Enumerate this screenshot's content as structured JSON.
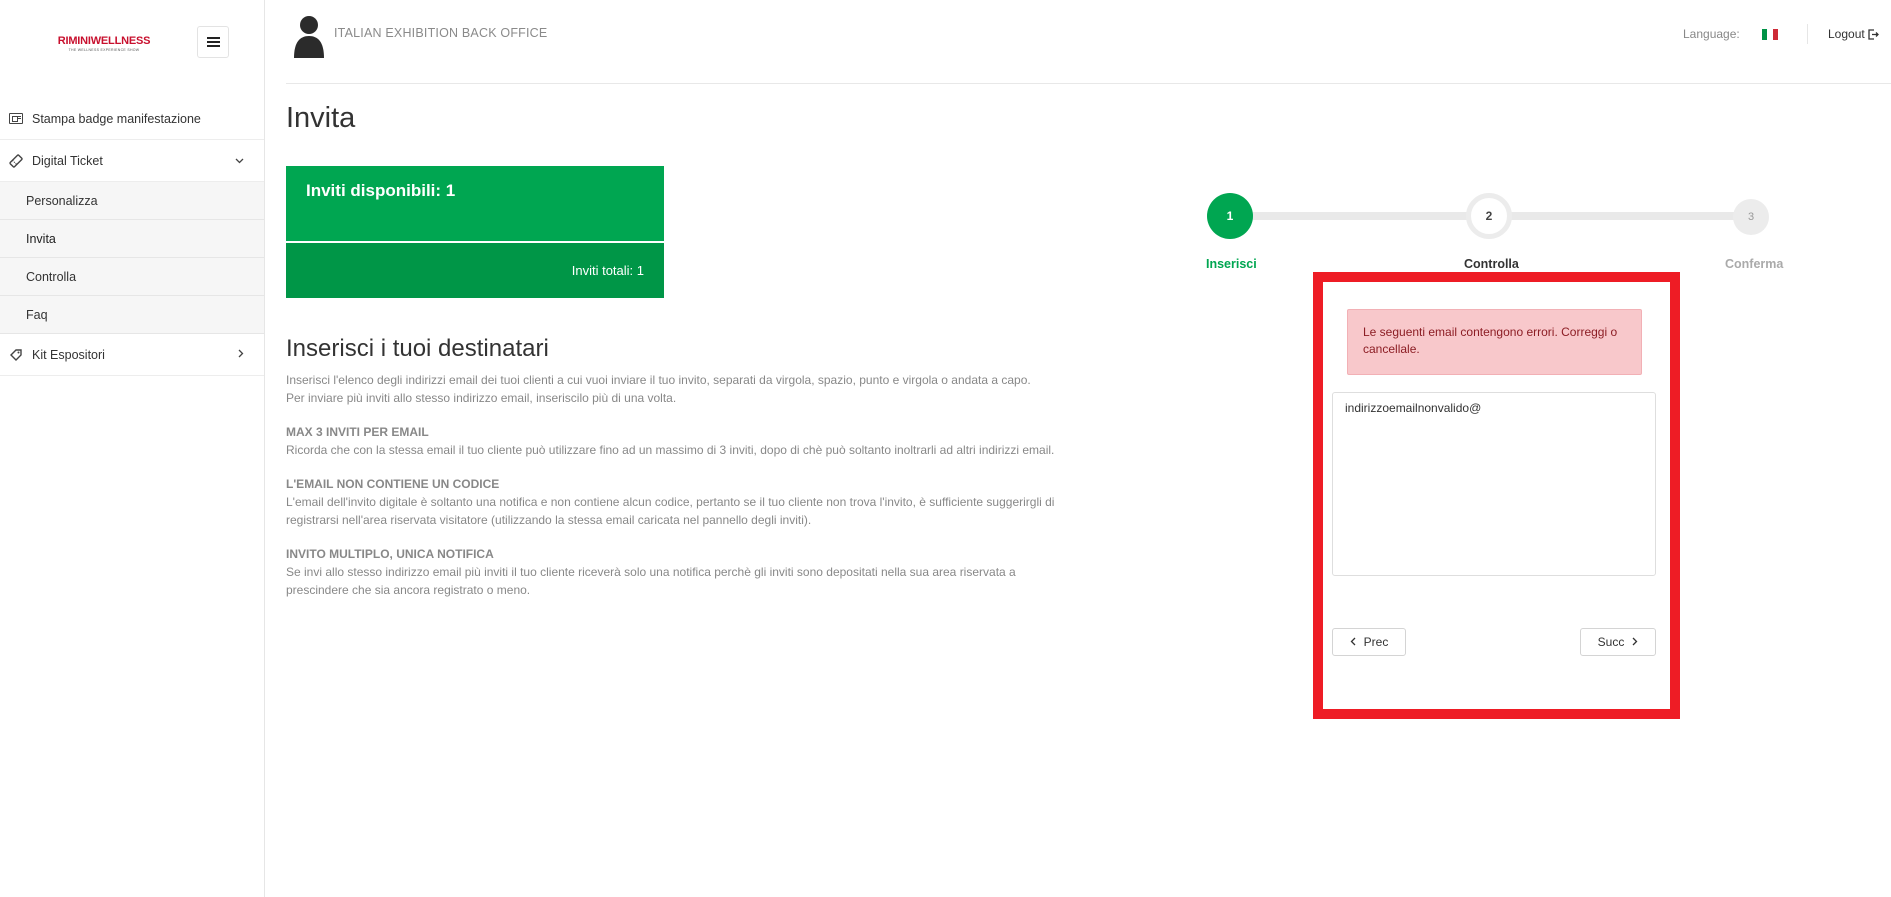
{
  "sidebar": {
    "logo_main": "RIMINIWELLNESS",
    "logo_sub": "THE WELLNESS EXPERIENCE SHOW",
    "items": [
      {
        "label": "Stampa badge manifestazione",
        "icon": "badge-icon"
      },
      {
        "label": "Digital Ticket",
        "icon": "ticket-icon",
        "expanded": true,
        "children": [
          {
            "label": "Personalizza"
          },
          {
            "label": "Invita",
            "active": true
          },
          {
            "label": "Controlla"
          },
          {
            "label": "Faq"
          }
        ]
      },
      {
        "label": "Kit Espositori",
        "icon": "tag-icon",
        "expanded": false
      }
    ]
  },
  "header": {
    "title": "ITALIAN EXHIBITION BACK OFFICE",
    "language_label": "Language:",
    "language_flag": "italian-flag-icon",
    "logout_label": "Logout"
  },
  "page": {
    "title": "Invita",
    "invites_available": "Inviti disponibili: 1",
    "invites_total": "Inviti totali: 1",
    "section_title": "Inserisci i tuoi destinatari",
    "intro_line1": "Inserisci l'elenco degli indirizzi email dei tuoi clienti a cui vuoi inviare il tuo invito, separati da virgola, spazio, punto e virgola o andata a capo.",
    "intro_line2": "Per inviare più inviti allo stesso indirizzo email, inseriscilo più di una volta.",
    "max_title": "MAX 3 INVITI PER EMAIL",
    "max_text": "Ricorda che con la stessa email il tuo cliente può utilizzare fino ad un massimo di 3 inviti, dopo di chè può soltanto inoltrarli ad altri indirizzi email.",
    "nocode_title": "L'EMAIL NON CONTIENE UN CODICE",
    "nocode_text": "L'email dell'invito digitale è soltanto una notifica e non contiene alcun codice, pertanto se il tuo cliente non trova l'invito, è sufficiente suggerirgli di registrarsi nell'area riservata visitatore (utilizzando la stessa email caricata nel pannello degli inviti).",
    "multi_title": "INVITO MULTIPLO, UNICA NOTIFICA",
    "multi_text": "Se invi allo stesso indirizzo email più inviti il tuo cliente riceverà solo una notifica perchè gli inviti sono depositati nella sua area riservata a prescindere che sia ancora registrato o meno."
  },
  "stepper": {
    "steps": [
      {
        "number": "1",
        "label": "Inserisci",
        "state": "active"
      },
      {
        "number": "2",
        "label": "Controlla",
        "state": "current"
      },
      {
        "number": "3",
        "label": "Conferma",
        "state": "pending"
      }
    ],
    "accent_color": "#00a651"
  },
  "form": {
    "error_message": "Le seguenti email contengono errori. Correggi o cancellale.",
    "emails_value": "indirizzoemailnonvalido@",
    "prev_label": "Prec",
    "next_label": "Succ",
    "highlight_color": "#ee1c25"
  }
}
